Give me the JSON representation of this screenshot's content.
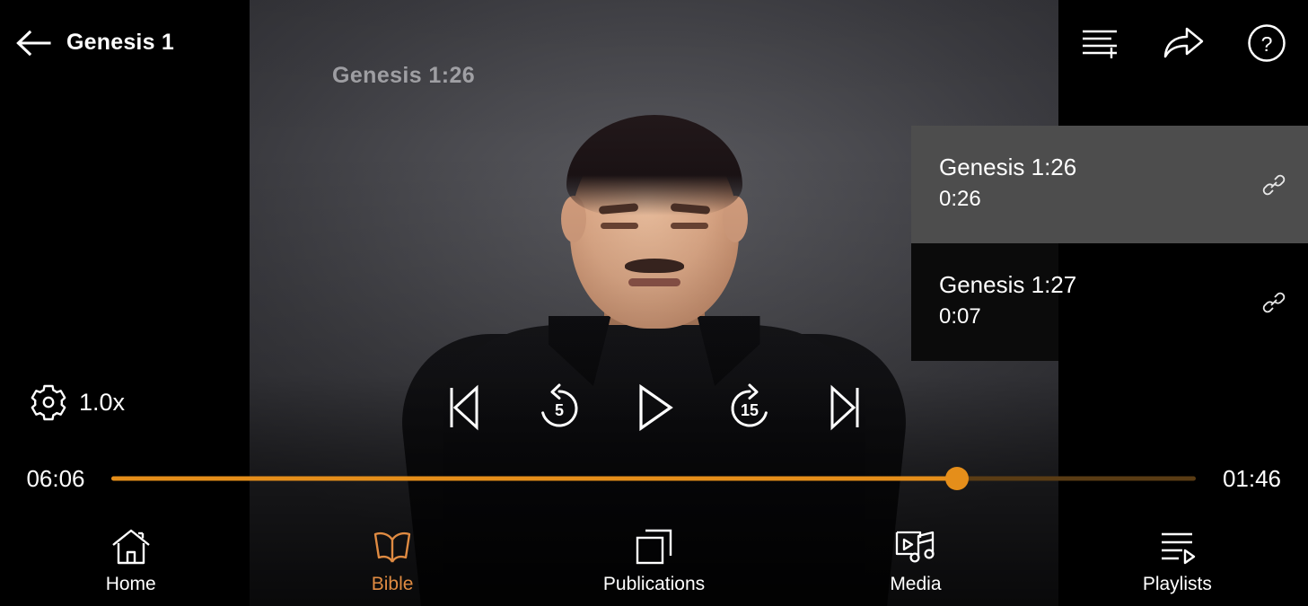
{
  "app": {
    "accent_color": "#e08b42",
    "progress_color": "#e58e1a",
    "background_color": "#000000"
  },
  "header": {
    "back_icon": "back-arrow-icon",
    "title": "Genesis 1",
    "actions": [
      {
        "name": "add-to-playlist-icon",
        "label": "Add to playlist"
      },
      {
        "name": "share-icon",
        "label": "Share"
      },
      {
        "name": "help-icon",
        "label": "Help"
      }
    ]
  },
  "video": {
    "caption": "Genesis 1:26"
  },
  "marker_panel": {
    "items": [
      {
        "title": "Genesis 1:26",
        "time": "0:26",
        "active": true,
        "link_icon": "link-icon"
      },
      {
        "title": "Genesis 1:27",
        "time": "0:07",
        "active": false,
        "link_icon": "link-icon"
      }
    ]
  },
  "player": {
    "speed": {
      "icon": "gear-icon",
      "label": "1.0x"
    },
    "transport": [
      {
        "name": "previous-track-button",
        "label": "Previous",
        "glyph": "skip-back"
      },
      {
        "name": "rewind-5-button",
        "label": "5",
        "glyph": "replay"
      },
      {
        "name": "play-button",
        "label": "Play",
        "glyph": "play"
      },
      {
        "name": "forward-15-button",
        "label": "15",
        "glyph": "forward"
      },
      {
        "name": "next-track-button",
        "label": "Next",
        "glyph": "skip-forward"
      }
    ],
    "timeline": {
      "elapsed": "06:06",
      "remaining": "01:46",
      "progress_percent": 78
    }
  },
  "bottom_nav": {
    "items": [
      {
        "label": "Home",
        "icon": "home-icon",
        "active": false
      },
      {
        "label": "Bible",
        "icon": "bible-book-icon",
        "active": true
      },
      {
        "label": "Publications",
        "icon": "publications-icon",
        "active": false
      },
      {
        "label": "Media",
        "icon": "media-icon",
        "active": false
      },
      {
        "label": "Playlists",
        "icon": "playlists-icon",
        "active": false
      }
    ]
  }
}
